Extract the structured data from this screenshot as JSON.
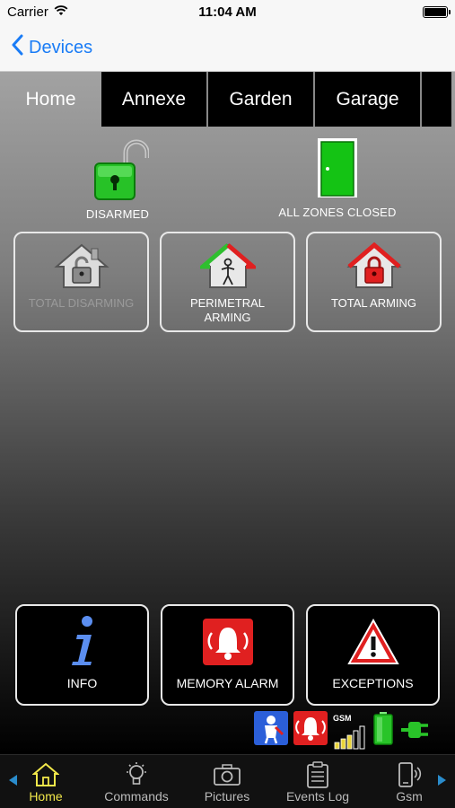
{
  "status_bar": {
    "carrier": "Carrier",
    "time": "11:04 AM"
  },
  "nav": {
    "back_label": "Devices"
  },
  "tabs": [
    {
      "label": "Home",
      "active": true
    },
    {
      "label": "Annexe",
      "active": false
    },
    {
      "label": "Garden",
      "active": false
    },
    {
      "label": "Garage",
      "active": false
    }
  ],
  "status": {
    "arm_state": "DISARMED",
    "zones_state": "ALL ZONES CLOSED"
  },
  "commands": {
    "total_disarming": "TOTAL DISARMING",
    "perimetral_arming_line1": "PERIMETRAL",
    "perimetral_arming_line2": "ARMING",
    "total_arming": "TOTAL ARMING"
  },
  "bottom_buttons": {
    "info": "INFO",
    "memory_alarm": "MEMORY ALARM",
    "exceptions": "EXCEPTIONS"
  },
  "indicator_icons": [
    "technician-icon",
    "alarm-bell-icon",
    "gsm-signal-icon",
    "battery-icon",
    "power-plug-icon"
  ],
  "gsm_label": "GSM",
  "tab_bar": [
    {
      "label": "Home",
      "icon": "house-icon",
      "active": true
    },
    {
      "label": "Commands",
      "icon": "lightbulb-icon",
      "active": false
    },
    {
      "label": "Pictures",
      "icon": "camera-icon",
      "active": false
    },
    {
      "label": "Events Log",
      "icon": "clipboard-icon",
      "active": false
    },
    {
      "label": "Gsm",
      "icon": "phone-icon",
      "active": false
    }
  ],
  "colors": {
    "accent_blue": "#1a7cf6",
    "active_tab_yellow": "#f2e84a",
    "lock_green": "#2fd12f",
    "alarm_red": "#e02020"
  }
}
